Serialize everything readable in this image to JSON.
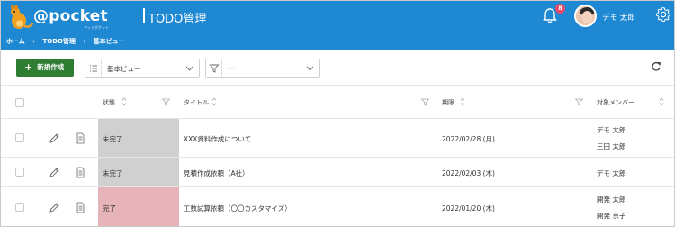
{
  "header": {
    "brand": "@pocket",
    "brand_sub": "アットポケット",
    "app_title": "TODO管理",
    "notification_count": "8",
    "user_name": "デモ 太郎"
  },
  "breadcrumb": [
    "ホーム",
    "TODO管理",
    "基本ビュー"
  ],
  "toolbar": {
    "new_button": "新規作成",
    "view_select_value": "基本ビュー",
    "filter_select_value": "---"
  },
  "table": {
    "columns": [
      "状態",
      "タイトル",
      "期限",
      "対象メンバー"
    ],
    "rows": [
      {
        "status": "未完了",
        "title": "XXX資料作成について",
        "due": "2022/02/28 (月)",
        "members": [
          "デモ 太郎",
          "三田 太郎"
        ]
      },
      {
        "status": "未完了",
        "title": "見積作成依頼（A社）",
        "due": "2022/02/03 (木)",
        "members": [
          "デモ 太郎"
        ]
      },
      {
        "status": "完了",
        "title": "工数試算依頼（〇〇カスタマイズ）",
        "due": "2022/01/20 (木)",
        "members": [
          "開発 太郎",
          "開発 京子"
        ]
      }
    ]
  },
  "colors": {
    "header_bg": "#1e88d2",
    "new_button_bg": "#2e7d32",
    "status_incomplete_bg": "#d0d0d0",
    "status_complete_bg": "#e6b4b8",
    "badge_bg": "#e84a6b"
  },
  "icons": [
    "kangaroo-logo-icon",
    "bell-icon",
    "gear-icon",
    "list-icon",
    "filter-icon",
    "chevron-down-icon",
    "refresh-icon",
    "sort-icon",
    "pencil-icon",
    "document-icon"
  ]
}
